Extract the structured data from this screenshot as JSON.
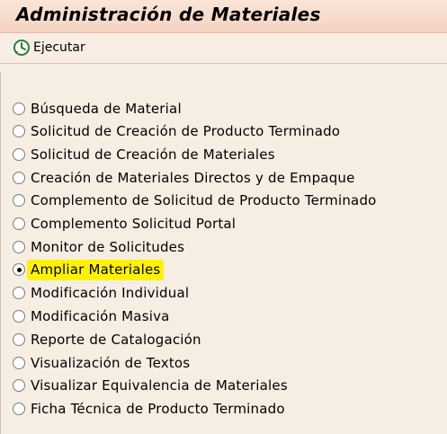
{
  "window": {
    "title": "Administración de Materiales"
  },
  "toolbar": {
    "execute_label": "Ejecutar"
  },
  "options": [
    {
      "label": "Búsqueda de Material",
      "selected": false
    },
    {
      "label": "Solicitud de Creación de Producto Terminado",
      "selected": false
    },
    {
      "label": "Solicitud de Creación de Materiales",
      "selected": false
    },
    {
      "label": "Creación de Materiales Directos y de Empaque",
      "selected": false
    },
    {
      "label": "Complemento de Solicitud de Producto Terminado",
      "selected": false
    },
    {
      "label": "Complemento Solicitud Portal",
      "selected": false
    },
    {
      "label": "Monitor de Solicitudes",
      "selected": false
    },
    {
      "label": "Ampliar Materiales",
      "selected": true,
      "highlight": "#fff200"
    },
    {
      "label": "Modificación Individual",
      "selected": false
    },
    {
      "label": "Modificación Masiva",
      "selected": false
    },
    {
      "label": "Reporte de Catalogación",
      "selected": false
    },
    {
      "label": "Visualización de Textos",
      "selected": false
    },
    {
      "label": "Visualizar Equivalencia de Materiales",
      "selected": false
    },
    {
      "label": "Ficha Técnica de Producto Terminado",
      "selected": false
    }
  ],
  "colors": {
    "title_bar": "#f3d3c2",
    "background": "#f6ede3",
    "highlight": "#fff200"
  }
}
